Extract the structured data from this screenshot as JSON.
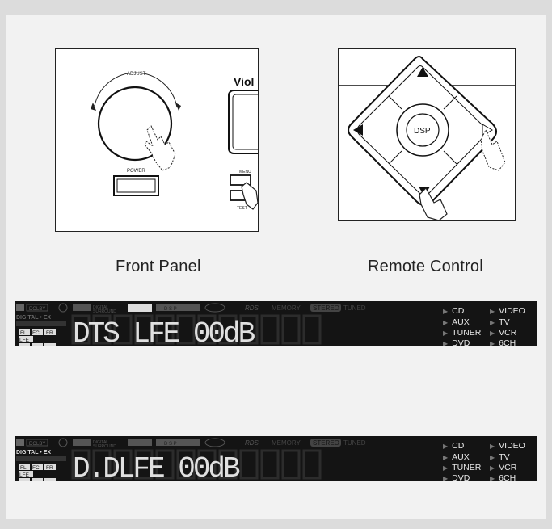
{
  "front_panel": {
    "caption": "Front Panel",
    "adjust_label": "ADJUST",
    "power_label": "POWER",
    "menu_label": "MENU",
    "test_label": "TEST",
    "brand_partial": "Viol"
  },
  "remote_control": {
    "caption": "Remote Control",
    "center_label": "DSP"
  },
  "displays": [
    {
      "badges": [
        "DOLBY",
        "DIGITAL",
        "SURROUND",
        "D S P",
        "RDS",
        "MEMORY",
        "STEREO",
        "TUNED"
      ],
      "digital_ex": "DIGITAL • EX",
      "channels": [
        "FL",
        "FC",
        "FR",
        "LFE",
        "SL",
        "SC",
        "SR"
      ],
      "text": "DTS LFE 00dB",
      "sources": [
        "CD",
        "VIDEO",
        "AUX",
        "TV",
        "TUNER",
        "VCR",
        "DVD",
        "6CH"
      ]
    },
    {
      "badges": [
        "DOLBY",
        "DIGITAL",
        "SURROUND",
        "D S P",
        "RDS",
        "MEMORY",
        "STEREO",
        "TUNED"
      ],
      "digital_ex": "DIGITAL • EX",
      "channels": [
        "FL",
        "FC",
        "FR",
        "LFE",
        "SL",
        "SC",
        "SR"
      ],
      "text": "D.DLFE  00dB",
      "sources": [
        "CD",
        "VIDEO",
        "AUX",
        "TV",
        "TUNER",
        "VCR",
        "DVD",
        "6CH"
      ]
    }
  ]
}
